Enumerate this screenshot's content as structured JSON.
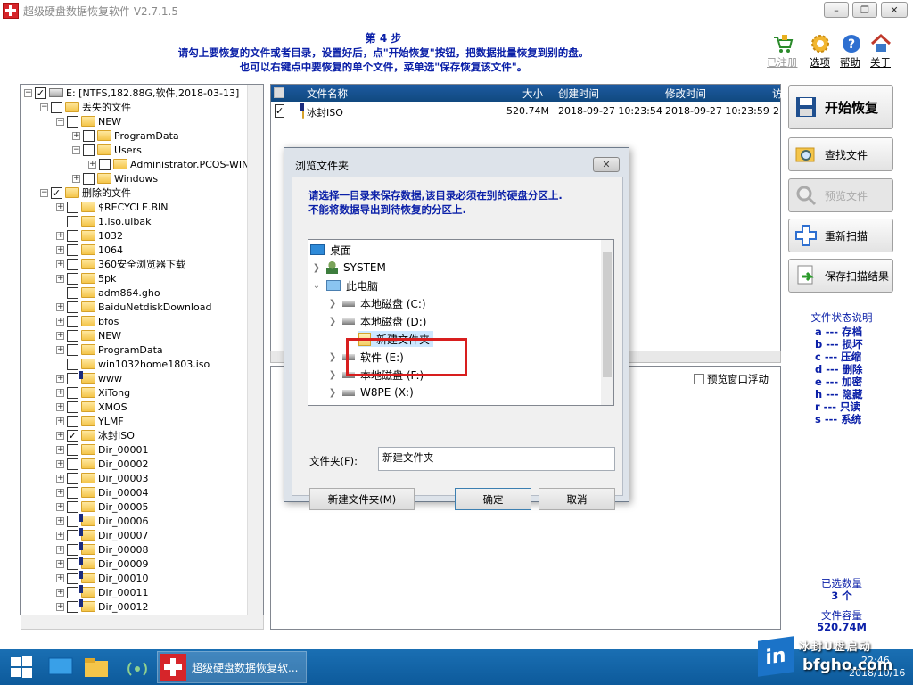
{
  "window": {
    "title": "超级硬盘数据恢复软件 V2.7.1.5",
    "minimize": "–",
    "maximize": "❐",
    "close": "✕"
  },
  "header": {
    "step": "第 4 步",
    "line1": "请勾上要恢复的文件或者目录，设置好后，点\"开始恢复\"按钮，把数据批量恢复到别的盘。",
    "line2": "也可以右键点中要恢复的单个文件，菜单选\"保存恢复该文件\"。",
    "actions": [
      {
        "label": "已注册",
        "icon": "cart-icon"
      },
      {
        "label": "选项",
        "icon": "gear-icon"
      },
      {
        "label": "帮助",
        "icon": "help-icon"
      },
      {
        "label": "关于",
        "icon": "home-icon"
      }
    ]
  },
  "tree": {
    "root": "E:  [NTFS,182.88G,软件,2018-03-13]",
    "lost": "丢失的文件",
    "lost_children": [
      "NEW",
      "ProgramData",
      "Users",
      "Administrator.PCOS-WIN1",
      "Windows"
    ],
    "deleted": "删除的文件",
    "deleted_children": [
      "$RECYCLE.BIN",
      "1.iso.uibak",
      "1032",
      "1064",
      "360安全浏览器下载",
      "5pk",
      "adm864.gho",
      "BaiduNetdiskDownload",
      "bfos",
      "NEW",
      "ProgramData",
      "win1032home1803.iso",
      "www",
      "XiTong",
      "XMOS",
      "YLMF",
      "冰封ISO",
      "Dir_00001",
      "Dir_00002",
      "Dir_00003",
      "Dir_00004",
      "Dir_00005",
      "Dir_00006",
      "Dir_00007",
      "Dir_00008",
      "Dir_00009",
      "Dir_00010",
      "Dir_00011",
      "Dir_00012"
    ]
  },
  "list": {
    "columns": {
      "name": "文件名称",
      "size": "大小",
      "created": "创建时间",
      "modified": "修改时间",
      "extra": "访"
    },
    "rows": [
      {
        "name": "冰封ISO",
        "size": "520.74M",
        "created": "2018-09-27 10:23:54",
        "modified": "2018-09-27 10:23:59",
        "extra": "2"
      }
    ]
  },
  "preview": {
    "float_label": "预览窗口浮动"
  },
  "buttons": {
    "start": "开始恢复",
    "find": "查找文件",
    "preview": "预览文件",
    "rescan": "重新扫描",
    "save_scan": "保存扫描结果"
  },
  "status": {
    "title": "文件状态说明",
    "items": [
      {
        "key": "a",
        "text": "存档"
      },
      {
        "key": "b",
        "text": "损坏"
      },
      {
        "key": "c",
        "text": "压缩"
      },
      {
        "key": "d",
        "text": "删除"
      },
      {
        "key": "e",
        "text": "加密"
      },
      {
        "key": "h",
        "text": "隐藏"
      },
      {
        "key": "r",
        "text": "只读"
      },
      {
        "key": "s",
        "text": "系统"
      }
    ],
    "dash": "---",
    "selected_label": "已选数量",
    "selected_value": "3 个",
    "capacity_label": "文件容量",
    "capacity_value": "520.74M"
  },
  "dialog": {
    "title": "浏览文件夹",
    "message1": "请选择一目录来保存数据,该目录必须在别的硬盘分区上.",
    "message2": "不能将数据导出到待恢复的分区上.",
    "tree": {
      "desktop": "桌面",
      "system": "SYSTEM",
      "pc": "此电脑",
      "c": "本地磁盘 (C:)",
      "d": "本地磁盘 (D:)",
      "new_folder": "新建文件夹",
      "e": "软件 (E:)",
      "f": "本地磁盘 (F:)",
      "x": "W8PE (X:)"
    },
    "folder_label": "文件夹(F):",
    "folder_value": "新建文件夹",
    "new_folder_button": "新建文件夹(M)",
    "ok": "确定",
    "cancel": "取消"
  },
  "taskbar": {
    "app_label": "超级硬盘数据恢复软...",
    "time": "22:46",
    "date": "2018/10/16"
  },
  "watermark": {
    "line1": "冰封U盘启动",
    "line2": "bfgho.com"
  }
}
